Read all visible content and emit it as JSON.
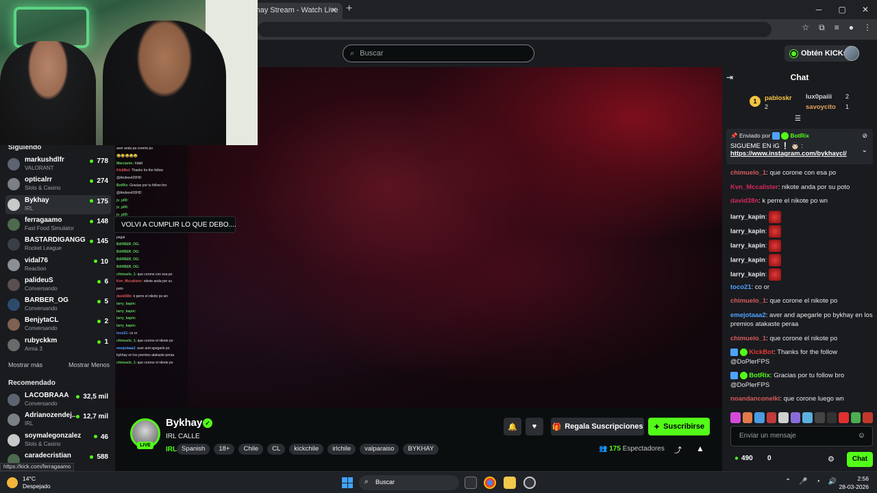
{
  "browser": {
    "tab_title": "khay Stream - Watch Live",
    "close_glyph": "✕",
    "new_tab_glyph": "+",
    "window_controls": [
      "─",
      "▢",
      "✕"
    ]
  },
  "header": {
    "search_placeholder": "Buscar",
    "kicks_button": "Obtén KICKs"
  },
  "sidebar": {
    "following_heading": "Siguiendo",
    "following": [
      {
        "name": "markushdlfr",
        "category": "VALORANT",
        "viewers": "778"
      },
      {
        "name": "opticalrr",
        "category": "Slots & Casino",
        "viewers": "274"
      },
      {
        "name": "Bykhay",
        "category": "IRL",
        "viewers": "175"
      },
      {
        "name": "ferragaamo",
        "category": "Fast Food Simulator",
        "viewers": "148"
      },
      {
        "name": "BASTARDIGANGG",
        "category": "Rocket League",
        "viewers": "145"
      },
      {
        "name": "vidal76",
        "category": "Reaction",
        "viewers": "10"
      },
      {
        "name": "palideuS",
        "category": "Conversando",
        "viewers": "6"
      },
      {
        "name": "BARBER_OG",
        "category": "Conversando",
        "viewers": "5"
      },
      {
        "name": "BenjytaCL",
        "category": "Conversando",
        "viewers": "2"
      },
      {
        "name": "rubyckkm",
        "category": "Arma 3",
        "viewers": "1"
      }
    ],
    "show_more": "Mostrar más",
    "show_less": "Mostrar Menos",
    "recommended_heading": "Recomendado",
    "recommended": [
      {
        "name": "LACOBRAAA",
        "category": "Conversando",
        "viewers": "32,5 mil"
      },
      {
        "name": "Adrianozendej...",
        "category": "IRL",
        "viewers": "12,7 mil"
      },
      {
        "name": "soymalegonzalez",
        "category": "Slots & Casino",
        "viewers": "46"
      },
      {
        "name": "caradecristian",
        "category": "",
        "viewers": "588"
      }
    ],
    "status_url": "https://kick.com/ferragaamo",
    "tooltip": "VOLVI A CUMPLIR LO QUE DEBO...."
  },
  "overlay_chat": [
    {
      "user": "",
      "text": "aver anda pa creerte po",
      "cls": ""
    },
    {
      "user": "",
      "text": "😂😂😂😂😂",
      "cls": ""
    },
    {
      "user": "Marcianin:",
      "text": "Xddd",
      "cls": ""
    },
    {
      "user": "KickBot:",
      "text": "Thanks for the follow",
      "cls": "r"
    },
    {
      "user": "",
      "text": "@Andres420HD",
      "cls": ""
    },
    {
      "user": "BotRix:",
      "text": "Gracias por tu follow bro",
      "cls": ""
    },
    {
      "user": "",
      "text": "@Andres420HD",
      "cls": ""
    },
    {
      "user": "jv_p00:",
      "text": "",
      "cls": ""
    },
    {
      "user": "jv_p00:",
      "text": "",
      "cls": ""
    },
    {
      "user": "jv_p00:",
      "text": "",
      "cls": ""
    },
    {
      "user": "",
      "text": "",
      "cls": ""
    },
    {
      "user": "",
      "text": "",
      "cls": ""
    },
    {
      "user": "",
      "text": "",
      "cls": "r"
    },
    {
      "user": "",
      "text": "",
      "cls": "r"
    },
    {
      "user": "emejotaaa2:",
      "text": "anda",
      "cls": "b"
    },
    {
      "user": "",
      "text": "",
      "cls": "r"
    },
    {
      "user": "",
      "text": "",
      "cls": "r"
    },
    {
      "user": "",
      "text": "ascercatele y le",
      "cls": "r"
    },
    {
      "user": "",
      "text": "pegai",
      "cls": ""
    },
    {
      "user": "BARBER_OG:",
      "text": "",
      "cls": ""
    },
    {
      "user": "BARBER_OG:",
      "text": "",
      "cls": ""
    },
    {
      "user": "BARBER_OG:",
      "text": "",
      "cls": ""
    },
    {
      "user": "BARBER_OG:",
      "text": "",
      "cls": ""
    },
    {
      "user": "chimuelo_1:",
      "text": "que corone con esa po",
      "cls": ""
    },
    {
      "user": "Kvn_Mccalister:",
      "text": "nikote anda por su",
      "cls": "r"
    },
    {
      "user": "",
      "text": "poto",
      "cls": ""
    },
    {
      "user": "david38n:",
      "text": "k perre el nikote po wn",
      "cls": "r"
    },
    {
      "user": "larry_kapin:",
      "text": "",
      "cls": ""
    },
    {
      "user": "larry_kapin:",
      "text": "",
      "cls": ""
    },
    {
      "user": "larry_kapin:",
      "text": "",
      "cls": ""
    },
    {
      "user": "larry_kapin:",
      "text": "",
      "cls": ""
    },
    {
      "user": "toco21:",
      "text": "co or",
      "cls": "b"
    },
    {
      "user": "chimuelo_1:",
      "text": "que corone el nikote po",
      "cls": ""
    },
    {
      "user": "emejotaaa2:",
      "text": "aver and apegarle po",
      "cls": "b"
    },
    {
      "user": "",
      "text": "bykhay en los premios atakaste peraa",
      "cls": ""
    },
    {
      "user": "chimuelo_1:",
      "text": "que corone el nikote po",
      "cls": ""
    }
  ],
  "stream": {
    "streamer": "Bykhay",
    "live_badge": "LIVE",
    "title": "IRL CALLE",
    "category": "IRL",
    "tags": [
      "Spanish",
      "18+",
      "Chile",
      "CL",
      "kickchile",
      "irlchile",
      "valparaiso",
      "BYKHAY"
    ],
    "gift_button": "Regala Suscripciones",
    "subscribe_button": "Suscribirse",
    "viewer_count": "175",
    "viewer_label": "Espectadores"
  },
  "chat": {
    "title": "Chat",
    "leaderboard": [
      {
        "name": "pabloskr",
        "value": "2",
        "color": "#f5c542"
      },
      {
        "name": "lux0paiii",
        "value": "2",
        "color": "#cfd3d8"
      },
      {
        "name": "savoycito",
        "value": "1",
        "color": "#e3a15a"
      }
    ],
    "pinned_by_label": "Enviado por",
    "pinned_by_user": "BotRix",
    "pinned_text": "SIGUEME EN iG ❕ 👨🏻 :",
    "pinned_link": "https://www.instagram.com/bykhaycl/",
    "messages": [
      {
        "user": "chimuelo_1",
        "color": "#d65b5b",
        "text": "que corone con esa po",
        "emotes": 0,
        "badges": false
      },
      {
        "user": "Kvn_Mccalister",
        "color": "#d6285a",
        "text": "nikote anda por su poto",
        "emotes": 0,
        "badges": false
      },
      {
        "user": "david38n",
        "color": "#d6285a",
        "text": "k perre el nikote po wn",
        "emotes": 0,
        "badges": false
      },
      {
        "user": "larry_kapin",
        "color": "#e7e9ea",
        "text": "",
        "emotes": 1,
        "badges": false
      },
      {
        "user": "larry_kapin",
        "color": "#e7e9ea",
        "text": "",
        "emotes": 1,
        "badges": false
      },
      {
        "user": "larry_kapin",
        "color": "#e7e9ea",
        "text": "",
        "emotes": 1,
        "badges": false
      },
      {
        "user": "larry_kapin",
        "color": "#e7e9ea",
        "text": "",
        "emotes": 1,
        "badges": false
      },
      {
        "user": "larry_kapin",
        "color": "#e7e9ea",
        "text": "",
        "emotes": 1,
        "badges": false
      },
      {
        "user": "toco21",
        "color": "#4fa3ff",
        "text": "co or",
        "emotes": 0,
        "badges": false
      },
      {
        "user": "chimuelo_1",
        "color": "#d65b5b",
        "text": "que corone el nikote po",
        "emotes": 0,
        "badges": false
      },
      {
        "user": "emejotaaa2",
        "color": "#4fa3ff",
        "text": "aver and apegarle po bykhay en los premios atakaste peraa",
        "emotes": 0,
        "badges": false
      },
      {
        "user": "chimuelo_1",
        "color": "#d65b5b",
        "text": "que corone el nikote po",
        "emotes": 0,
        "badges": false
      },
      {
        "user": "KickBot",
        "color": "#e53935",
        "text": "Thanks for the follow @DoPlerFPS",
        "emotes": 0,
        "badges": true
      },
      {
        "user": "BotRix",
        "color": "#53fc18",
        "text": "Gracias por tu follow bro @DoPlerFPS",
        "emotes": 0,
        "badges": true
      },
      {
        "user": "noandanconelki",
        "color": "#d65b5b",
        "text": "que corone luego wn",
        "emotes": 0,
        "badges": false
      }
    ],
    "input_placeholder": "Enviar un mensaje",
    "kicks_balance": "490",
    "store_count": "0",
    "send_button": "Chat"
  },
  "taskbar": {
    "temperature": "14°C",
    "weather": "Despejado",
    "search_label": "Buscar",
    "time": "2:56",
    "date": "28-03-2026"
  },
  "accent_color": "#53fc18"
}
